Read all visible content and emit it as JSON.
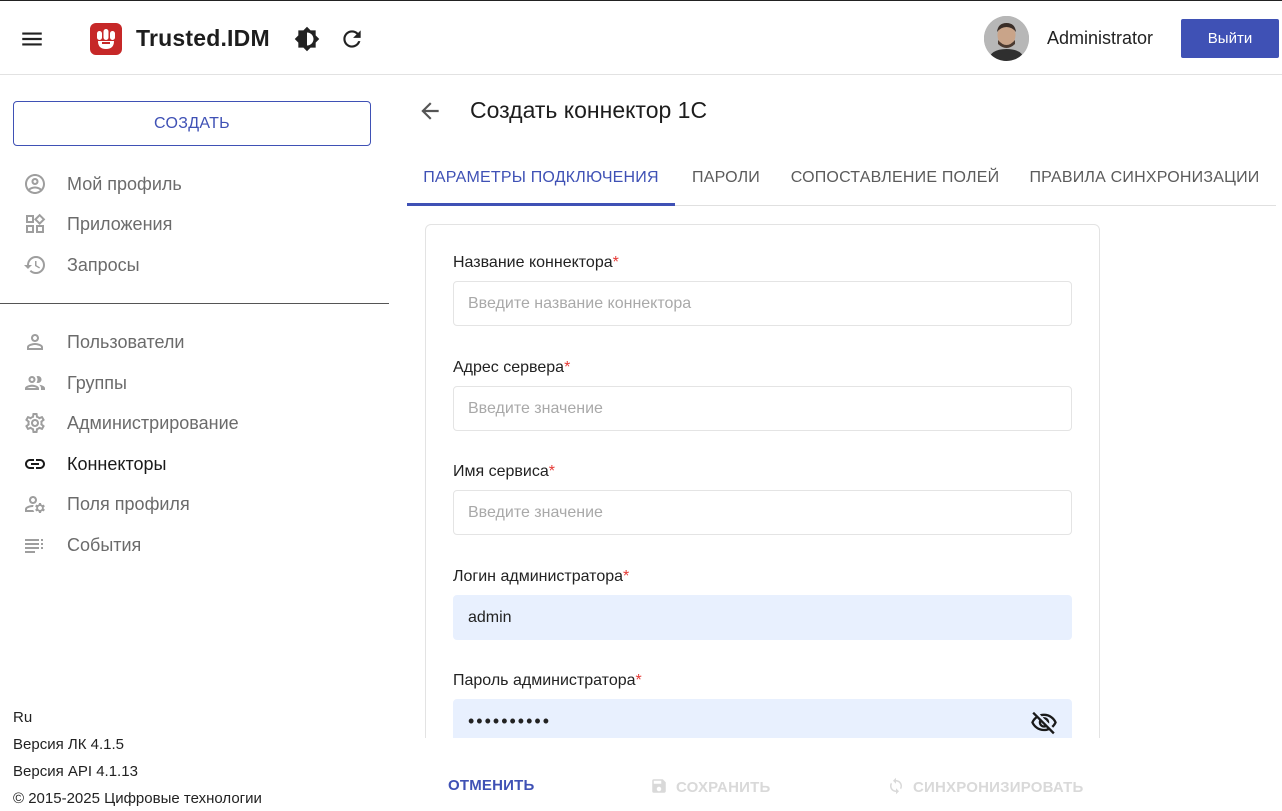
{
  "header": {
    "brand": "Trusted.IDM",
    "username": "Administrator",
    "logout_label": "Выйти"
  },
  "sidebar": {
    "create_label": "СОЗДАТЬ",
    "items": [
      {
        "label": "Мой профиль",
        "icon": "account-circle-icon"
      },
      {
        "label": "Приложения",
        "icon": "widgets-icon"
      },
      {
        "label": "Запросы",
        "icon": "history-icon"
      },
      {
        "label": "Пользователи",
        "icon": "person-icon"
      },
      {
        "label": "Группы",
        "icon": "group-icon"
      },
      {
        "label": "Администрирование",
        "icon": "gear-icon"
      },
      {
        "label": "Коннекторы",
        "icon": "link-icon"
      },
      {
        "label": "Поля профиля",
        "icon": "person-settings-icon"
      },
      {
        "label": "События",
        "icon": "list-icon"
      }
    ],
    "active_item": "Коннекторы",
    "footer": {
      "language": "Ru",
      "version_lk": "Версия ЛК 4.1.5",
      "version_api": "Версия API 4.1.13",
      "copyright": "© 2015-2025 Цифровые технологии"
    }
  },
  "page": {
    "title": "Создать коннектор 1С",
    "tabs": [
      {
        "label": "ПАРАМЕТРЫ ПОДКЛЮЧЕНИЯ",
        "active": true
      },
      {
        "label": "ПАРОЛИ",
        "active": false
      },
      {
        "label": "СОПОСТАВЛЕНИЕ ПОЛЕЙ",
        "active": false
      },
      {
        "label": "ПРАВИЛА СИНХРОНИЗАЦИИ",
        "active": false
      }
    ]
  },
  "form": {
    "connector_name": {
      "label": "Название коннектора",
      "required": "*",
      "placeholder": "Введите название коннектора",
      "value": ""
    },
    "server_address": {
      "label": "Адрес сервера",
      "required": "*",
      "placeholder": "Введите значение",
      "value": ""
    },
    "service_name": {
      "label": "Имя сервиса",
      "required": "*",
      "placeholder": "Введите значение",
      "value": ""
    },
    "admin_login": {
      "label": "Логин администратора",
      "required": "*",
      "value": "admin"
    },
    "admin_password": {
      "label": "Пароль администратора",
      "required": "*",
      "value": "••••••••••"
    }
  },
  "actions": {
    "cancel": "ОТМЕНИТЬ",
    "save": "СОХРАНИТЬ",
    "sync": "СИНХРОНИЗИРОВАТЬ"
  },
  "colors": {
    "accent": "#3f51b5",
    "logo": "#c62828",
    "required": "#e53935",
    "autofill": "#e8f0fe"
  }
}
